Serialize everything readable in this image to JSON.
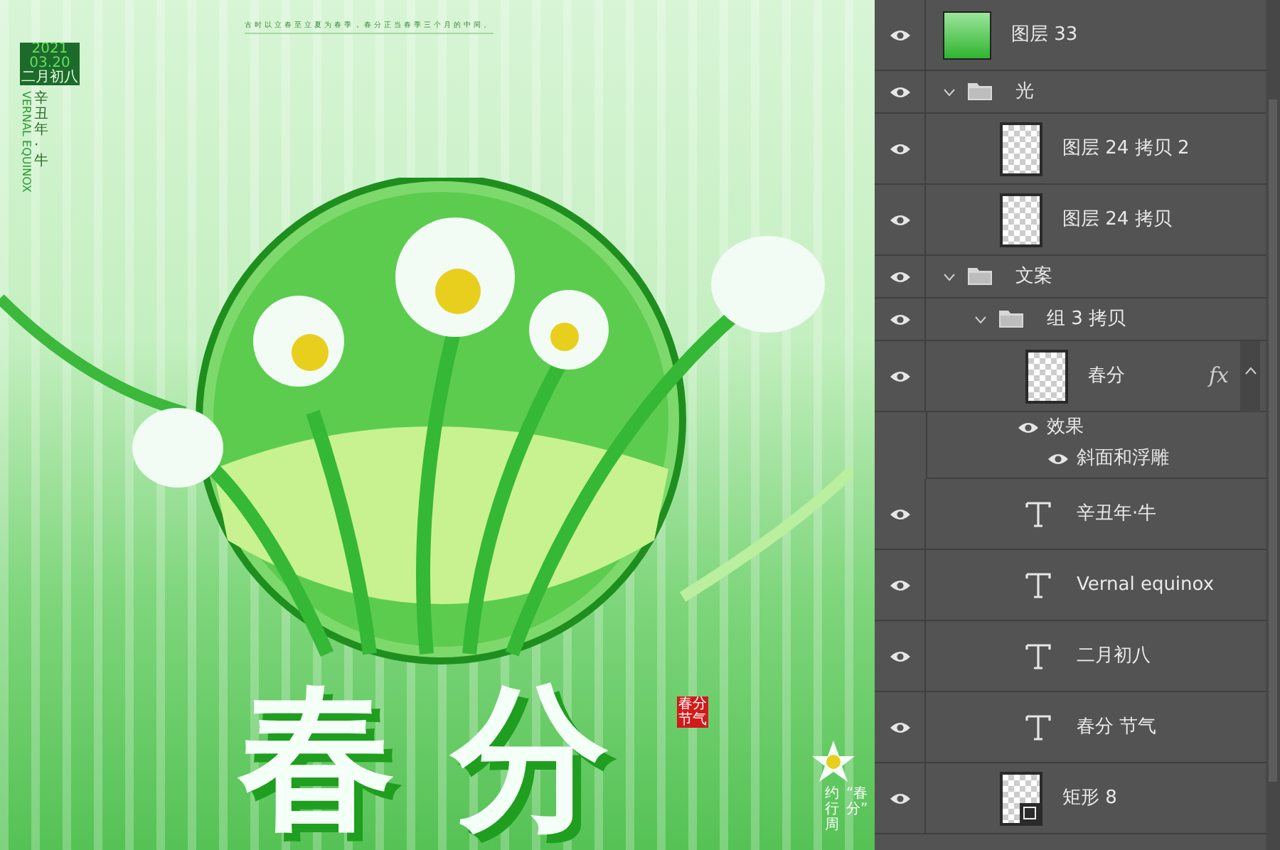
{
  "poster": {
    "top_note": "古时以立春至立夏为春季，春分正当春季三个月的中间。",
    "year": "2021",
    "date": "03.20",
    "lunar_date": "二月初八",
    "year_name": "辛丑年·牛",
    "english": "VERNAL EQUINOX",
    "title": "春分",
    "seal": [
      "春分",
      "节气"
    ],
    "side_note": [
      "约行周",
      "“春分”"
    ]
  },
  "layers": [
    {
      "kind": "image",
      "name": "图层 33",
      "visible": true
    },
    {
      "kind": "group",
      "name": "光",
      "visible": true,
      "expanded": true,
      "children": [
        {
          "kind": "pixel",
          "name": "图层 24 拷贝 2",
          "visible": true
        },
        {
          "kind": "pixel",
          "name": "图层 24 拷贝",
          "visible": true
        }
      ]
    },
    {
      "kind": "group",
      "name": "文案",
      "visible": true,
      "expanded": true,
      "children": [
        {
          "kind": "group",
          "name": "组 3 拷贝",
          "visible": true,
          "expanded": true,
          "children": [
            {
              "kind": "pixel",
              "name": "春分",
              "visible": true,
              "fx": "fx",
              "effects_expanded": true,
              "effects": {
                "name": "效果",
                "visible": true,
                "items": [
                  {
                    "name": "斜面和浮雕",
                    "visible": true
                  }
                ]
              }
            },
            {
              "kind": "text",
              "name": "辛丑年·牛",
              "visible": true
            },
            {
              "kind": "text",
              "name": "Vernal equinox",
              "visible": true
            },
            {
              "kind": "text",
              "name": "二月初八",
              "visible": true
            },
            {
              "kind": "text",
              "name": "春分 节气",
              "visible": true
            }
          ]
        },
        {
          "kind": "shape",
          "name": "矩形 8",
          "visible": true
        }
      ]
    }
  ]
}
